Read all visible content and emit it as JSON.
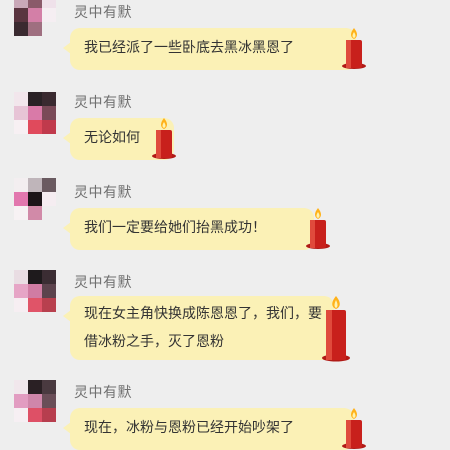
{
  "messages": [
    {
      "sender": "灵中有默",
      "text": "我已经派了一些卧底去黑冰黑恩了"
    },
    {
      "sender": "灵中有默",
      "text": "无论如何"
    },
    {
      "sender": "灵中有默",
      "text": "我们一定要给她们抬黑成功！"
    },
    {
      "sender": "灵中有默",
      "text": "现在女主角快换成陈恩恩了，我们，要借冰粉之手，灭了恩粉"
    },
    {
      "sender": "灵中有默",
      "text": "现在，冰粉与恩粉已经开始吵架了"
    }
  ],
  "icons": {
    "candle": "candle-icon",
    "avatar": "pixelated-avatar"
  },
  "colors": {
    "background": "#eeeeee",
    "bubble": "#fbf1b6",
    "sender_name": "#6f6f6f",
    "candle_red": "#c8201c",
    "flame": "#ffb21a"
  }
}
